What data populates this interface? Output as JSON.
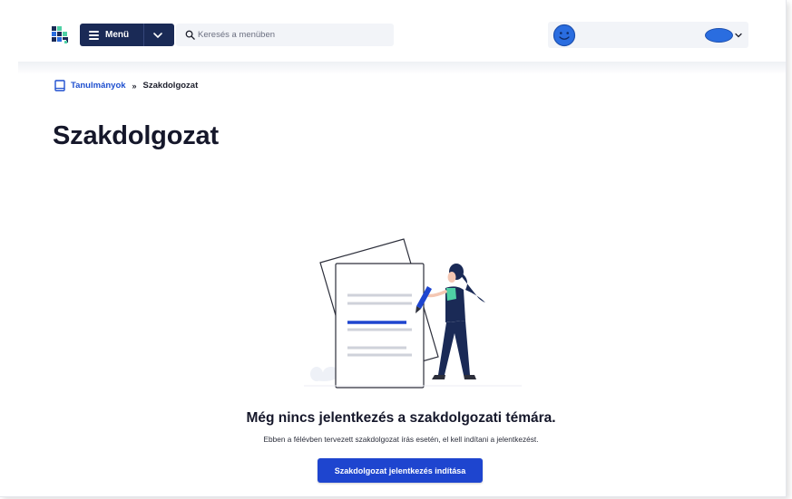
{
  "header": {
    "menu_label": "Menü",
    "search_placeholder": "Keresés a menüben"
  },
  "breadcrumb": {
    "parent": "Tanulmányok",
    "separator": "»",
    "current": "Szakdolgozat"
  },
  "page": {
    "title": "Szakdolgozat"
  },
  "empty_state": {
    "title": "Még nincs jelentkezés a szakdolgozati témára.",
    "description": "Ebben a félévben tervezett szakdolgozat írás esetén, el kell indítani a jelentkezést.",
    "button_label": "Szakdolgozat jelentkezés indítása"
  },
  "icons": {
    "logo": "neptun-logo-icon",
    "menu": "hamburger-icon",
    "search": "search-icon",
    "avatar": "smiley-avatar-icon",
    "breadcrumb": "book-icon"
  },
  "colors": {
    "navy": "#1a2a56",
    "primary": "#1e45cf",
    "link": "#1e4fcf",
    "accent_green": "#4fd1a5"
  }
}
